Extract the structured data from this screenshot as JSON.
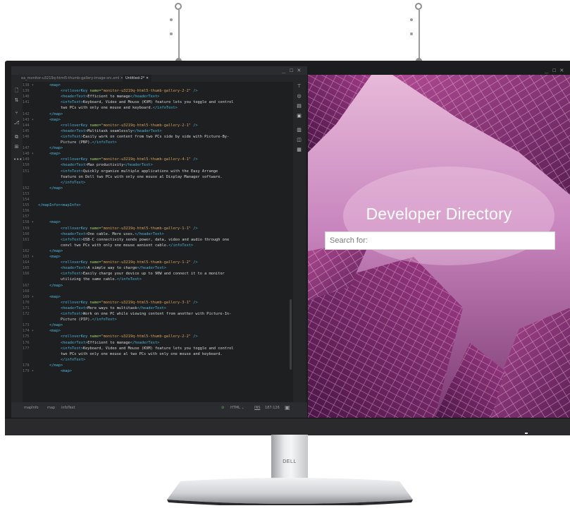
{
  "editor": {
    "tabs": [
      {
        "label": "ea_monitor-u3219q-html5-thumb-gallery-image-src.xml",
        "active": false
      },
      {
        "label": "Untitled-2*",
        "active": true
      }
    ],
    "window_controls": "_ ☐ ✕",
    "lines": [
      {
        "num": "138 ▾",
        "indent": 1,
        "parts": [
          [
            "t",
            "<map>"
          ]
        ]
      },
      {
        "num": "139",
        "indent": 2,
        "parts": [
          [
            "t",
            "<rolloverKey "
          ],
          [
            "a",
            "name="
          ],
          [
            "s",
            "\"monitor-u3219q-html5-thumb-gallery-2-2\""
          ],
          [
            "t",
            " />"
          ]
        ]
      },
      {
        "num": "140",
        "indent": 2,
        "parts": [
          [
            "t",
            "<headerText>"
          ],
          [
            "tx",
            "Efficient to manage"
          ],
          [
            "t",
            "</headerText>"
          ]
        ]
      },
      {
        "num": "141",
        "indent": 2,
        "parts": [
          [
            "t",
            "<infoText>"
          ],
          [
            "tx",
            "Keyboard, Video and Mouse (KVM) feature lets you toggle and control"
          ]
        ]
      },
      {
        "num": "",
        "indent": 2,
        "parts": [
          [
            "tx",
            "two PCs with only one mouse and keyboard."
          ],
          [
            "t",
            "</infoText>"
          ]
        ]
      },
      {
        "num": "142",
        "indent": 1,
        "parts": [
          [
            "t",
            "</map>"
          ]
        ]
      },
      {
        "num": "143 ▾",
        "indent": 1,
        "parts": [
          [
            "t",
            "<map>"
          ]
        ]
      },
      {
        "num": "144",
        "indent": 2,
        "parts": [
          [
            "t",
            "<rolloverKey "
          ],
          [
            "a",
            "name="
          ],
          [
            "s",
            "\"monitor-u3219q-html5-thumb-gallery-2-1\""
          ],
          [
            "t",
            " />"
          ]
        ]
      },
      {
        "num": "145",
        "indent": 2,
        "parts": [
          [
            "t",
            "<headerText>"
          ],
          [
            "tx",
            "Multitask seamlessly"
          ],
          [
            "t",
            "</headerText>"
          ]
        ]
      },
      {
        "num": "146",
        "indent": 2,
        "parts": [
          [
            "t",
            "<infoText>"
          ],
          [
            "tx",
            "Easily work on content from two PCs side by side with Picture-By-"
          ]
        ]
      },
      {
        "num": "",
        "indent": 2,
        "parts": [
          [
            "tx",
            "Picture (PBP)."
          ],
          [
            "t",
            "</infoText>"
          ]
        ]
      },
      {
        "num": "147",
        "indent": 1,
        "parts": [
          [
            "t",
            "</map>"
          ]
        ]
      },
      {
        "num": "148 ▾",
        "indent": 1,
        "parts": [
          [
            "t",
            "<map>"
          ]
        ]
      },
      {
        "num": "149",
        "indent": 2,
        "parts": [
          [
            "t",
            "<rolloverKey "
          ],
          [
            "a",
            "name="
          ],
          [
            "s",
            "\"monitor-u3219q-html5-thumb-gallery-4-1\""
          ],
          [
            "t",
            " />"
          ]
        ]
      },
      {
        "num": "150",
        "indent": 2,
        "parts": [
          [
            "t",
            "<headerText>"
          ],
          [
            "tx",
            "Max productivity"
          ],
          [
            "t",
            "</headerText>"
          ]
        ]
      },
      {
        "num": "151",
        "indent": 2,
        "parts": [
          [
            "t",
            "<infoText>"
          ],
          [
            "tx",
            "Quickly organize multiple applications with the Easy Arrange"
          ]
        ]
      },
      {
        "num": "",
        "indent": 2,
        "parts": [
          [
            "tx",
            "feature on Dell two PCs with only one mouse al Display Manager software."
          ]
        ]
      },
      {
        "num": "",
        "indent": 2,
        "parts": [
          [
            "t",
            "</infoText>"
          ]
        ]
      },
      {
        "num": "152",
        "indent": 1,
        "parts": [
          [
            "t",
            "</map>"
          ]
        ]
      },
      {
        "num": "153",
        "indent": 0,
        "parts": []
      },
      {
        "num": "154",
        "indent": 0,
        "parts": []
      },
      {
        "num": "155",
        "indent": 0,
        "parts": [
          [
            "t",
            "</mapInfo><mapInfo>"
          ]
        ]
      },
      {
        "num": "156",
        "indent": 0,
        "parts": []
      },
      {
        "num": "157",
        "indent": 0,
        "parts": []
      },
      {
        "num": "158 ▾",
        "indent": 1,
        "parts": [
          [
            "t",
            "<map>"
          ]
        ]
      },
      {
        "num": "159",
        "indent": 2,
        "parts": [
          [
            "t",
            "<rolloverKey "
          ],
          [
            "a",
            "name="
          ],
          [
            "s",
            "\"monitor-u3219q-html5-thumb-gallery-1-1\""
          ],
          [
            "t",
            " />"
          ]
        ]
      },
      {
        "num": "160",
        "indent": 2,
        "parts": [
          [
            "t",
            "<headerText>"
          ],
          [
            "tx",
            "One cable. More uses."
          ],
          [
            "t",
            "</headerText>"
          ]
        ]
      },
      {
        "num": "161",
        "indent": 2,
        "parts": [
          [
            "t",
            "<infoText>"
          ],
          [
            "tx",
            "USB-C connectivity sends power, data, video and audio through one"
          ]
        ]
      },
      {
        "num": "",
        "indent": 2,
        "parts": [
          [
            "tx",
            "convl two PCs with only one mouse aenient cable."
          ],
          [
            "t",
            "</infoText>"
          ]
        ]
      },
      {
        "num": "162",
        "indent": 1,
        "parts": [
          [
            "t",
            "</map>"
          ]
        ]
      },
      {
        "num": "163 ▾",
        "indent": 1,
        "parts": [
          [
            "t",
            "<map>"
          ]
        ]
      },
      {
        "num": "164",
        "indent": 2,
        "parts": [
          [
            "t",
            "<rolloverKey "
          ],
          [
            "a",
            "name="
          ],
          [
            "s",
            "\"monitor-u3219q-html5-thumb-gallery-1-2\""
          ],
          [
            "t",
            " />"
          ]
        ]
      },
      {
        "num": "165",
        "indent": 2,
        "parts": [
          [
            "t",
            "<headerText>"
          ],
          [
            "tx",
            "A simple way to charge"
          ],
          [
            "t",
            "</headerText>"
          ]
        ]
      },
      {
        "num": "166",
        "indent": 2,
        "parts": [
          [
            "t",
            "<infoText>"
          ],
          [
            "tx",
            "Easily charge your device up to 90W and connect it to a monitor"
          ]
        ]
      },
      {
        "num": "",
        "indent": 2,
        "parts": [
          [
            "tx",
            "utilizing the same cable."
          ],
          [
            "t",
            "</infoText>"
          ]
        ]
      },
      {
        "num": "167",
        "indent": 1,
        "parts": [
          [
            "t",
            "</map>"
          ]
        ]
      },
      {
        "num": "168",
        "indent": 0,
        "parts": []
      },
      {
        "num": "169 ▾",
        "indent": 1,
        "parts": [
          [
            "t",
            "<map>"
          ]
        ]
      },
      {
        "num": "170",
        "indent": 2,
        "parts": [
          [
            "t",
            "<rolloverKey "
          ],
          [
            "a",
            "name="
          ],
          [
            "s",
            "\"monitor-u3219q-html5-thumb-gallery-3-1\""
          ],
          [
            "t",
            " />"
          ]
        ]
      },
      {
        "num": "171",
        "indent": 2,
        "parts": [
          [
            "t",
            "<headerText>"
          ],
          [
            "tx",
            "More ways to multitask"
          ],
          [
            "t",
            "</headerText>"
          ]
        ]
      },
      {
        "num": "172",
        "indent": 2,
        "parts": [
          [
            "t",
            "<infoText>"
          ],
          [
            "tx",
            "Work on one PC while viewing content from another with Picture-In-"
          ]
        ]
      },
      {
        "num": "",
        "indent": 2,
        "parts": [
          [
            "tx",
            "Picture (PIP)."
          ],
          [
            "t",
            "</infoText>"
          ]
        ]
      },
      {
        "num": "173",
        "indent": 1,
        "parts": [
          [
            "t",
            "</map>"
          ]
        ]
      },
      {
        "num": "174 ▾",
        "indent": 1,
        "parts": [
          [
            "t",
            "<map>"
          ]
        ]
      },
      {
        "num": "175",
        "indent": 2,
        "parts": [
          [
            "t",
            "<rolloverKey "
          ],
          [
            "a",
            "name="
          ],
          [
            "s",
            "\"monitor-u3219q-html5-thumb-gallery-2-2\""
          ],
          [
            "t",
            " />"
          ]
        ]
      },
      {
        "num": "176",
        "indent": 2,
        "parts": [
          [
            "t",
            "<headerText>"
          ],
          [
            "tx",
            "Efficient to manage"
          ],
          [
            "t",
            "</headerText>"
          ]
        ]
      },
      {
        "num": "177",
        "indent": 2,
        "parts": [
          [
            "t",
            "<infoText>"
          ],
          [
            "tx",
            "Keyboard, Video and Mouse (KVM) feature lets you toggle and control"
          ]
        ]
      },
      {
        "num": "",
        "indent": 2,
        "parts": [
          [
            "tx",
            "two PCs with only one mouse al two PCs with only one mouse and keyboard."
          ]
        ]
      },
      {
        "num": "",
        "indent": 2,
        "parts": [
          [
            "t",
            "</infoText>"
          ]
        ]
      },
      {
        "num": "178",
        "indent": 1,
        "parts": [
          [
            "t",
            "</map>"
          ]
        ]
      },
      {
        "num": "179 ▾",
        "indent": 2,
        "parts": [
          [
            "t",
            "<map>"
          ]
        ]
      }
    ],
    "status": {
      "breadcrumb": [
        "mapInfo",
        "map",
        "infoText"
      ],
      "language": "HTML",
      "mode": "INS",
      "position": "187:126"
    }
  },
  "browser": {
    "window_controls": "_ ☐ ✕",
    "hero_title": "Developer Directory",
    "search_placeholder": "Search for:"
  },
  "stand": {
    "brand": "DELL"
  },
  "icons": {
    "left_tools": [
      "file-icon",
      "sort-icon",
      "branch-icon",
      "git-icon",
      "copy-icon",
      "extension-icon",
      "more-icon"
    ],
    "right_tools": [
      "sitemap-icon",
      "preview-icon",
      "snippet-icon",
      "image-icon",
      "clipboard-icon",
      "database-icon",
      "layers-icon"
    ]
  }
}
